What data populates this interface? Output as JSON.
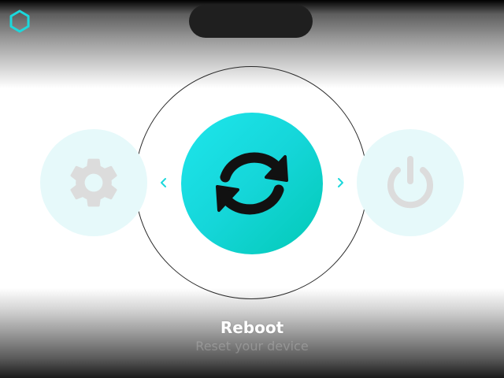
{
  "icons": {
    "brand": "hexagon-logo-icon",
    "prev": "chevron-left-icon",
    "next": "chevron-right-icon",
    "settings": "gear-icon",
    "reboot": "refresh-icon",
    "power": "power-icon"
  },
  "colors": {
    "accent": "#1cd8dc",
    "accent_dark": "#02c9b6",
    "side_bg": "#e6f9fa",
    "side_icon": "#dcdcdc",
    "pill": "#1f1f1f"
  },
  "carousel": {
    "selected": {
      "title": "Reboot",
      "subtitle": "Reset your device"
    }
  }
}
